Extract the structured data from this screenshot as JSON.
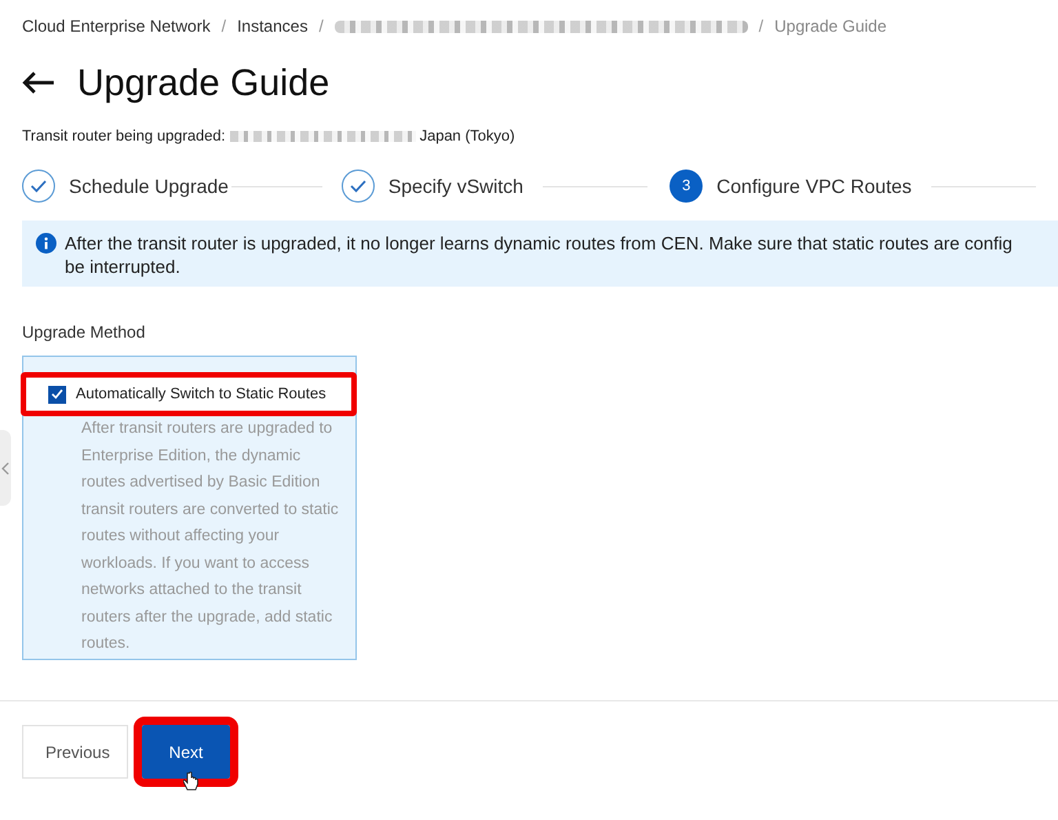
{
  "breadcrumb": [
    {
      "label": "Cloud Enterprise Network",
      "kind": "link"
    },
    {
      "separator": "/",
      "label": "Instances",
      "kind": "link"
    },
    {
      "separator": "/",
      "kind": "redacted"
    },
    {
      "separator": "/",
      "label": "Upgrade Guide",
      "kind": "current"
    }
  ],
  "page_title": "Upgrade Guide",
  "subtitle": {
    "label": "Transit router being upgraded:",
    "region": "Japan (Tokyo)"
  },
  "steps": [
    {
      "label": "Schedule Upgrade",
      "completed": true
    },
    {
      "label": "Specify vSwitch",
      "completed": true
    },
    {
      "number": "3",
      "label": "Configure VPC Routes",
      "completed": false
    }
  ],
  "alert": {
    "lines": [
      "After the transit router is upgraded, it no longer learns dynamic routes from CEN. Make sure that static routes are config",
      "be interrupted."
    ]
  },
  "upgrade_method": {
    "label": "Upgrade Method",
    "option": {
      "label": "Automatically Switch to Static Routes",
      "checked": true,
      "highlighted": true,
      "description": "After transit routers are upgraded to Enterprise Edition, the dynamic routes advertised by Basic Edition transit routers are converted to static routes without affecting your workloads. If you want to access networks attached to the transit routers after the upgrade, add static routes."
    }
  },
  "buttons": [
    {
      "label": "Previous",
      "kind": "secondary",
      "highlighted": false
    },
    {
      "label": "Next",
      "kind": "primary",
      "highlighted": true
    }
  ]
}
